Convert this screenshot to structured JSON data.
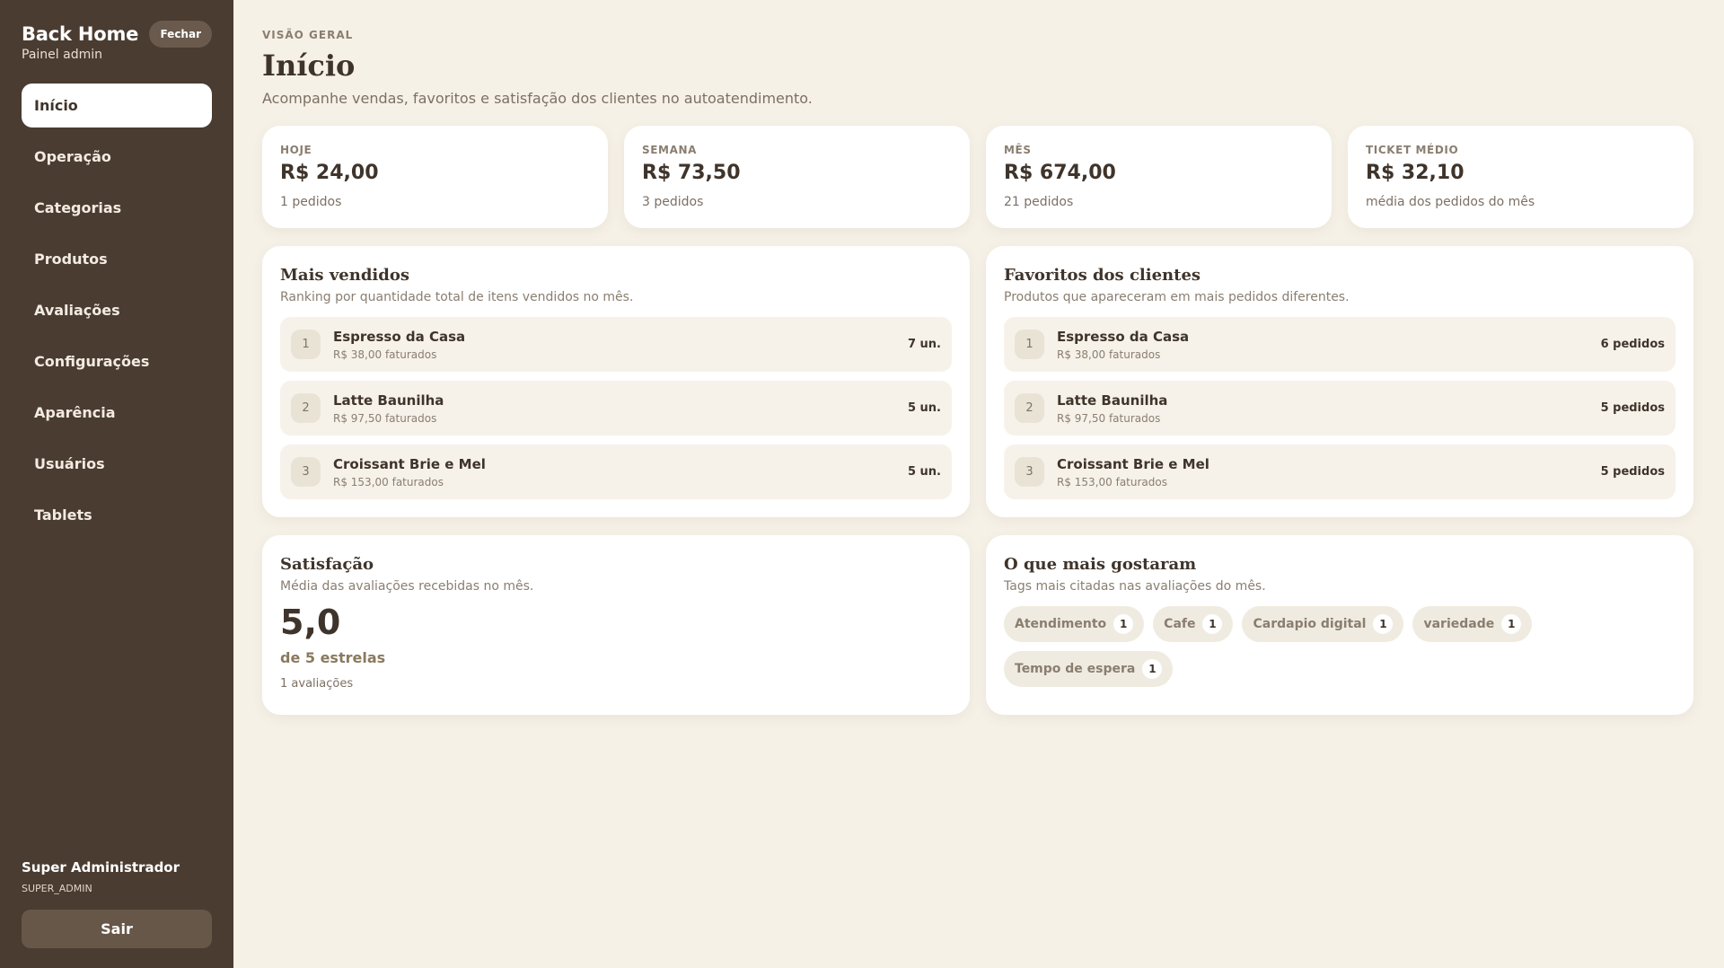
{
  "sidebar": {
    "brand": "Back Home",
    "subtitle": "Painel admin",
    "close_label": "Fechar",
    "items": [
      {
        "label": "Início"
      },
      {
        "label": "Operação"
      },
      {
        "label": "Categorias"
      },
      {
        "label": "Produtos"
      },
      {
        "label": "Avaliações"
      },
      {
        "label": "Configurações"
      },
      {
        "label": "Aparência"
      },
      {
        "label": "Usuários"
      },
      {
        "label": "Tablets"
      }
    ],
    "user_name": "Super Administrador",
    "user_role": "SUPER_ADMIN",
    "logout_label": "Sair"
  },
  "header": {
    "eyebrow": "VISÃO GERAL",
    "title": "Início",
    "description": "Acompanhe vendas, favoritos e satisfação dos clientes no autoatendimento."
  },
  "stats": [
    {
      "label": "HOJE",
      "value": "R$ 24,00",
      "sub": "1 pedidos"
    },
    {
      "label": "SEMANA",
      "value": "R$ 73,50",
      "sub": "3 pedidos"
    },
    {
      "label": "MÊS",
      "value": "R$ 674,00",
      "sub": "21 pedidos"
    },
    {
      "label": "TICKET MÉDIO",
      "value": "R$ 32,10",
      "sub": "média dos pedidos do mês"
    }
  ],
  "best_sellers": {
    "title": "Mais vendidos",
    "description": "Ranking por quantidade total de itens vendidos no mês.",
    "items": [
      {
        "rank": "1",
        "name": "Espresso da Casa",
        "sub": "R$ 38,00 faturados",
        "count": "7 un."
      },
      {
        "rank": "2",
        "name": "Latte Baunilha",
        "sub": "R$ 97,50 faturados",
        "count": "5 un."
      },
      {
        "rank": "3",
        "name": "Croissant Brie e Mel",
        "sub": "R$ 153,00 faturados",
        "count": "5 un."
      }
    ]
  },
  "favorites": {
    "title": "Favoritos dos clientes",
    "description": "Produtos que apareceram em mais pedidos diferentes.",
    "items": [
      {
        "rank": "1",
        "name": "Espresso da Casa",
        "sub": "R$ 38,00 faturados",
        "count": "6 pedidos"
      },
      {
        "rank": "2",
        "name": "Latte Baunilha",
        "sub": "R$ 97,50 faturados",
        "count": "5 pedidos"
      },
      {
        "rank": "3",
        "name": "Croissant Brie e Mel",
        "sub": "R$ 153,00 faturados",
        "count": "5 pedidos"
      }
    ]
  },
  "satisfaction": {
    "title": "Satisfação",
    "description": "Média das avaliações recebidas no mês.",
    "score": "5,0",
    "scale": "de 5 estrelas",
    "count": "1 avaliações"
  },
  "liked": {
    "title": "O que mais gostaram",
    "description": "Tags mais citadas nas avaliações do mês.",
    "tags": [
      {
        "label": "Atendimento",
        "count": "1"
      },
      {
        "label": "Cafe",
        "count": "1"
      },
      {
        "label": "Cardapio digital",
        "count": "1"
      },
      {
        "label": "variedade",
        "count": "1"
      },
      {
        "label": "Tempo de espera",
        "count": "1"
      }
    ]
  },
  "colors": {
    "sidebar_bg": "#4a3c31",
    "page_bg": "#f6f1e7",
    "text_primary": "#3f342b",
    "accent_muted": "#8a7a5e"
  }
}
